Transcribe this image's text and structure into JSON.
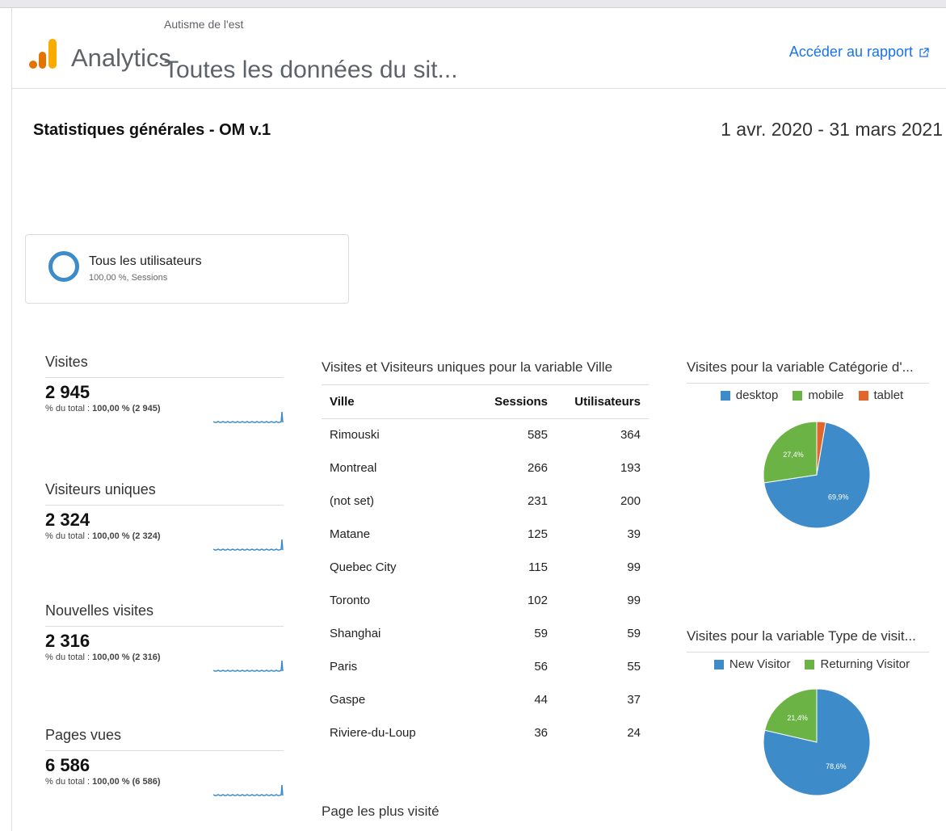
{
  "header": {
    "app_name": "Analytics",
    "account": "Autisme de l'est",
    "property": "Toutes les données du sit...",
    "access_link": "Accéder au rapport"
  },
  "report": {
    "title": "Statistiques générales - OM v.1",
    "date_range": "1 avr. 2020 - 31 mars 2021"
  },
  "segment": {
    "name": "Tous les utilisateurs",
    "detail": "100,00 %, Sessions"
  },
  "metrics": [
    {
      "title": "Visites",
      "value": "2 945",
      "pct_label": "% du total : ",
      "pct_value": "100,00 % (2 945)"
    },
    {
      "title": "Visiteurs uniques",
      "value": "2 324",
      "pct_label": "% du total : ",
      "pct_value": "100,00 % (2 324)"
    },
    {
      "title": "Nouvelles visites",
      "value": "2 316",
      "pct_label": "% du total : ",
      "pct_value": "100,00 % (2 316)"
    },
    {
      "title": "Pages vues",
      "value": "6 586",
      "pct_label": "% du total : ",
      "pct_value": "100,00 % (6 586)"
    }
  ],
  "city_table": {
    "title": "Visites et Visiteurs uniques pour la variable Ville",
    "headers": [
      "Ville",
      "Sessions",
      "Utilisateurs"
    ],
    "rows": [
      [
        "Rimouski",
        "585",
        "364"
      ],
      [
        "Montreal",
        "266",
        "193"
      ],
      [
        "(not set)",
        "231",
        "200"
      ],
      [
        "Matane",
        "125",
        "39"
      ],
      [
        "Quebec City",
        "115",
        "99"
      ],
      [
        "Toronto",
        "102",
        "99"
      ],
      [
        "Shanghai",
        "59",
        "59"
      ],
      [
        "Paris",
        "56",
        "55"
      ],
      [
        "Gaspe",
        "44",
        "37"
      ],
      [
        "Riviere-du-Loup",
        "36",
        "24"
      ]
    ]
  },
  "most_visited_title": "Page les plus visité",
  "colors": {
    "blue": "#3d8bc8",
    "green": "#6ab344",
    "orange": "#e0662b",
    "link": "#1a73e8"
  },
  "chart_data": [
    {
      "type": "pie",
      "title": "Visites pour la variable Catégorie d'...",
      "legend_position": "top",
      "categories": [
        "desktop",
        "mobile",
        "tablet"
      ],
      "values": [
        69.9,
        27.4,
        2.7
      ],
      "data_labels": [
        "69,9%",
        "27,4%",
        ""
      ]
    },
    {
      "type": "pie",
      "title": "Visites pour la variable Type de visit...",
      "legend_position": "top",
      "categories": [
        "New Visitor",
        "Returning Visitor"
      ],
      "values": [
        78.6,
        21.4
      ],
      "data_labels": [
        "78,6%",
        "21,4%"
      ]
    }
  ]
}
